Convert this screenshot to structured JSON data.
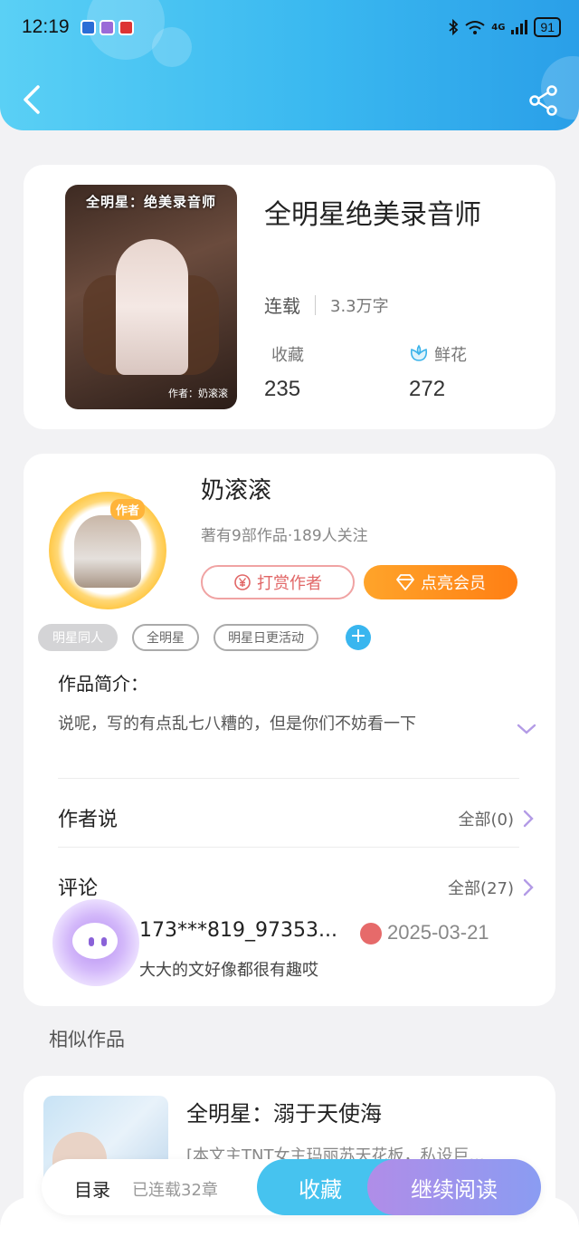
{
  "status_bar": {
    "time": "12:19",
    "battery": "91",
    "signal": "4G"
  },
  "header": {
    "back_icon": "chevron-left-icon",
    "share_icon": "share-icon"
  },
  "book": {
    "title": "全明星绝美录音师",
    "cover_title": "全明星：绝美录音师",
    "cover_byline": "作者：奶滚滚",
    "status": "连载",
    "word_count": "3.3万字",
    "favorites_label": "收藏",
    "favorites_count": "235",
    "flowers_label": "鲜花",
    "flowers_count": "272"
  },
  "author": {
    "tag": "作者",
    "name": "奶滚滚",
    "meta": "著有9部作品·189人关注",
    "tip_button": "打赏作者",
    "vip_button": "点亮会员",
    "tags": [
      "明星同人",
      "全明星",
      "明星日更活动"
    ],
    "intro_label": "作品简介：",
    "intro_text": "说呢，写的有点乱七八糟的，但是你们不妨看一下",
    "author_says_label": "作者说",
    "author_says_count": "全部(0)",
    "comments_label": "评论",
    "comments_count": "全部(27)",
    "comment": {
      "user": "173***819_97353...",
      "date": "2025-03-21",
      "text": "大大的文好像都很有趣哎"
    }
  },
  "similar": {
    "section_title": "相似作品",
    "item": {
      "title": "全明星：溺于天使海",
      "desc": "[本文主TNT女主玛丽苏天花板，私设巨..."
    }
  },
  "bottom_bar": {
    "toc_label": "目录",
    "chapters": "已连载32章",
    "favorite_button": "收藏",
    "read_button": "继续阅读"
  },
  "colors": {
    "header_gradient": [
      "#5ad0f5",
      "#2a9fe8"
    ],
    "vip_orange": "#ff8a1c",
    "tip_red": "#e16666",
    "read_purple": "#a58df0"
  }
}
